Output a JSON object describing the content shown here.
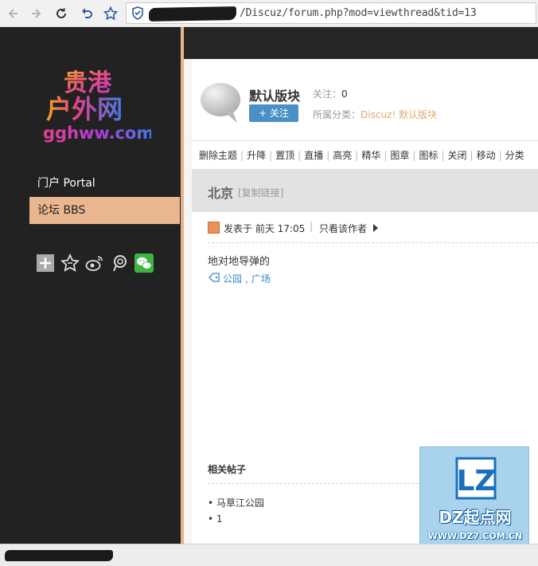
{
  "browser": {
    "url_visible": "/Discuz/forum.php?mod=viewthread&tid=13"
  },
  "sidebar": {
    "logo_line1": "贵港",
    "logo_line2": "户外网",
    "logo_domain": "gghww.com",
    "items": [
      {
        "label": "门户 Portal",
        "active": false
      },
      {
        "label": "论坛 BBS",
        "active": true
      }
    ],
    "share_icons": [
      "add-icon",
      "star-icon",
      "weibo-icon",
      "pengyou-icon",
      "wechat-icon"
    ]
  },
  "forum": {
    "title": "默认版块",
    "follow_label": "关注：",
    "follow_count": "0",
    "follow_button": "+ 关注",
    "category_label": "所属分类：",
    "category_value": "Discuz! 默认版块"
  },
  "moderation": {
    "actions": [
      "删除主题",
      "升降",
      "置顶",
      "直播",
      "高亮",
      "精华",
      "图章",
      "图标",
      "关闭",
      "移动",
      "分类"
    ]
  },
  "thread": {
    "title": "北京",
    "copy_link": "[复制链接]",
    "posted_at": "发表于 前天 17:05",
    "author_only": "只看该作者",
    "body": "地对地导弹的",
    "tags": [
      "公园",
      "广场"
    ]
  },
  "related": {
    "title": "相关帖子",
    "items": [
      "马草江公园",
      "1"
    ]
  },
  "watermark": {
    "logo_text": "LZ",
    "name": "DZ起点网",
    "url": "WWW.DZ7.COM.CN"
  },
  "colors": {
    "sidebar_bg": "#222222",
    "accent": "#e9b68f",
    "follow_btn": "#4a90c6",
    "link": "#3a87c9"
  }
}
